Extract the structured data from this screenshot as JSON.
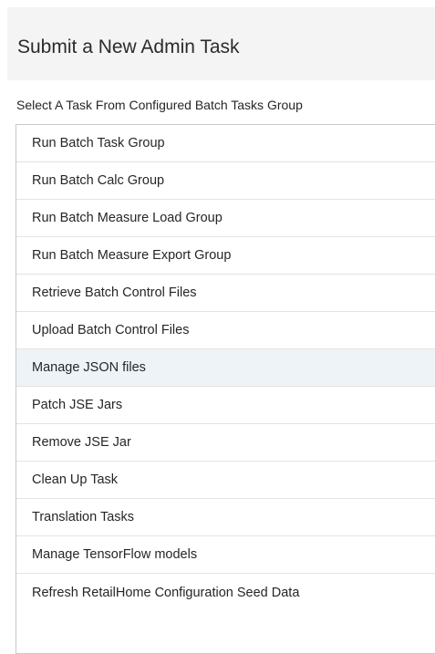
{
  "header": {
    "title": "Submit a New Admin Task"
  },
  "task_group": {
    "label": "Select A Task From Configured Batch Tasks Group",
    "selected_index": 6,
    "items": [
      {
        "label": "Run Batch Task Group"
      },
      {
        "label": "Run Batch Calc Group"
      },
      {
        "label": "Run Batch Measure Load Group"
      },
      {
        "label": "Run Batch Measure Export Group"
      },
      {
        "label": "Retrieve Batch Control Files"
      },
      {
        "label": "Upload Batch Control Files"
      },
      {
        "label": "Manage JSON files"
      },
      {
        "label": "Patch JSE Jars"
      },
      {
        "label": "Remove JSE Jar"
      },
      {
        "label": "Clean Up Task"
      },
      {
        "label": "Translation Tasks"
      },
      {
        "label": "Manage TensorFlow models"
      },
      {
        "label": "Refresh RetailHome Configuration Seed Data"
      }
    ]
  }
}
